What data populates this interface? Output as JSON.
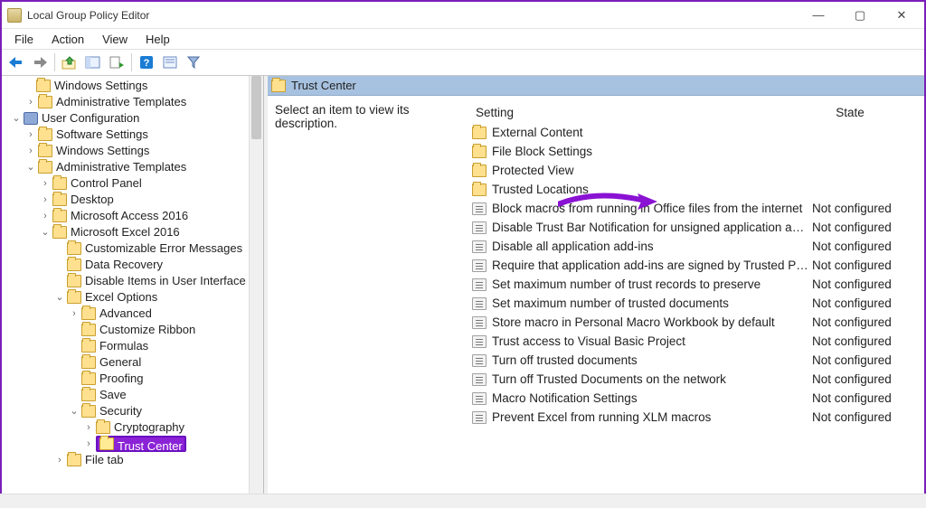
{
  "window": {
    "title": "Local Group Policy Editor"
  },
  "menubar": [
    "File",
    "Action",
    "View",
    "Help"
  ],
  "right": {
    "title": "Trust Center",
    "desc_prompt": "Select an item to view its description.",
    "cols": {
      "setting": "Setting",
      "state": "State"
    },
    "items": [
      {
        "kind": "folder",
        "name": "External Content",
        "state": ""
      },
      {
        "kind": "folder",
        "name": "File Block Settings",
        "state": ""
      },
      {
        "kind": "folder",
        "name": "Protected View",
        "state": ""
      },
      {
        "kind": "folder",
        "name": "Trusted Locations",
        "state": ""
      },
      {
        "kind": "policy",
        "name": "Block macros from running in Office files from the internet",
        "state": "Not configured"
      },
      {
        "kind": "policy",
        "name": "Disable Trust Bar Notification for unsigned application add-i...",
        "state": "Not configured"
      },
      {
        "kind": "policy",
        "name": "Disable all application add-ins",
        "state": "Not configured"
      },
      {
        "kind": "policy",
        "name": "Require that application add-ins are signed by Trusted Publis...",
        "state": "Not configured"
      },
      {
        "kind": "policy",
        "name": "Set maximum number of trust records to preserve",
        "state": "Not configured"
      },
      {
        "kind": "policy",
        "name": "Set maximum number of trusted documents",
        "state": "Not configured"
      },
      {
        "kind": "policy",
        "name": "Store macro in Personal Macro Workbook by default",
        "state": "Not configured"
      },
      {
        "kind": "policy",
        "name": "Trust access to Visual Basic Project",
        "state": "Not configured"
      },
      {
        "kind": "policy",
        "name": "Turn off trusted documents",
        "state": "Not configured"
      },
      {
        "kind": "policy",
        "name": "Turn off Trusted Documents on the network",
        "state": "Not configured"
      },
      {
        "kind": "policy",
        "name": "Macro Notification Settings",
        "state": "Not configured"
      },
      {
        "kind": "policy",
        "name": "Prevent Excel from running XLM macros",
        "state": "Not configured"
      }
    ]
  },
  "tree": {
    "l0a": "Windows Settings",
    "l0b": "Administrative Templates",
    "l1": "User Configuration",
    "l1a": "Software Settings",
    "l1b": "Windows Settings",
    "l1c": "Administrative Templates",
    "l2a": "Control Panel",
    "l2b": "Desktop",
    "l2c": "Microsoft Access 2016",
    "l2d": "Microsoft Excel 2016",
    "l3a": "Customizable Error Messages",
    "l3b": "Data Recovery",
    "l3c": "Disable Items in User Interface",
    "l3d": "Excel Options",
    "l4a": "Advanced",
    "l4b": "Customize Ribbon",
    "l4c": "Formulas",
    "l4d": "General",
    "l4e": "Proofing",
    "l4f": "Save",
    "l4g": "Security",
    "l5a": "Cryptography",
    "l5b": "Trust Center",
    "l3e": "File tab"
  }
}
